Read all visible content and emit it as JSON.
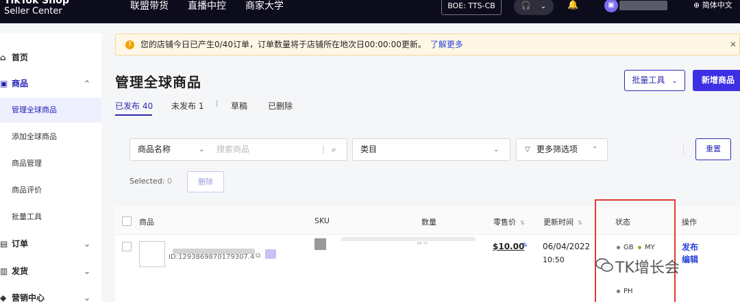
{
  "topbar": {
    "logo_line1": "TikTok Shop",
    "logo_line2": "Seller Center",
    "nav": [
      "联盟带货",
      "直播中控",
      "商家大学"
    ],
    "region_badge": "BOE: TTS-CB",
    "language": "简体中文"
  },
  "sidebar": {
    "home": "首页",
    "products": "商品",
    "products_sub": [
      "管理全球商品",
      "添加全球商品",
      "商品管理",
      "商品评价",
      "批量工具"
    ],
    "orders": "订单",
    "shipping": "发货",
    "marketing": "营销中心"
  },
  "notice": {
    "text": "您的店铺今日已产生0/40订单，订单数量将于店铺所在地次日00:00:00更新。",
    "link": "了解更多"
  },
  "header": {
    "title": "管理全球商品",
    "batch_button": "批量工具",
    "new_button": "新增商品"
  },
  "tabs": [
    {
      "label": "已发布 40"
    },
    {
      "label": "未发布 1"
    },
    {
      "label": "草稿"
    },
    {
      "label": "已删除"
    }
  ],
  "filters": {
    "name_select": "商品名称",
    "search_placeholder": "搜索商品",
    "category": "类目",
    "more_filters": "更多筛选项",
    "reset_button": "重置"
  },
  "selection": {
    "label": "Selected:",
    "count": "0",
    "delete_button": "删除"
  },
  "table": {
    "headers": [
      "商品",
      "SKU",
      "数量",
      "零售价",
      "更新时间",
      "状态",
      "操作"
    ],
    "row": {
      "product_id": "ID:1293869870179307.4",
      "quantity_fragment": "ᴮᴷ ᴵᴼ",
      "price": "$10.00",
      "date": "06/04/2022",
      "time": "10:50",
      "statuses": [
        {
          "code": "GB",
          "color": "#777777"
        },
        {
          "code": "MY",
          "color": "#7cb82f"
        },
        {
          "code": "PH",
          "color": "#777777"
        }
      ],
      "actions": [
        "发布",
        "编辑"
      ]
    }
  },
  "watermark": "TK增长会",
  "colors": {
    "accent": "#3d2fe3",
    "highlight_border": "#e23b2e"
  }
}
